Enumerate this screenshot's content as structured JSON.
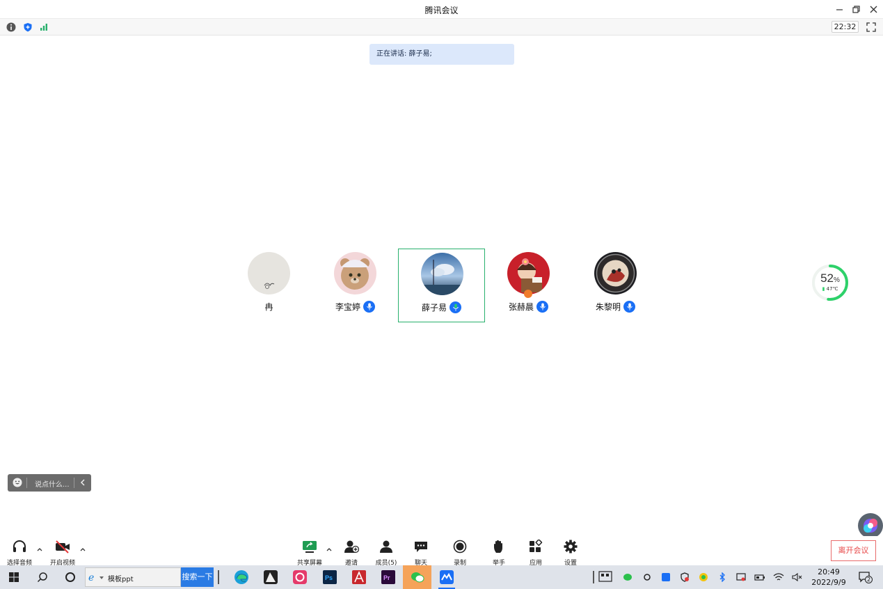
{
  "window": {
    "title": "腾讯会议"
  },
  "infobar": {
    "timer": "22:32"
  },
  "speaking": {
    "text": "正在讲话: 薛子易;"
  },
  "participants": [
    {
      "name": "冉",
      "mic": false
    },
    {
      "name": "李宝婷",
      "mic": true
    },
    {
      "name": "薛子易",
      "mic": true,
      "active": true
    },
    {
      "name": "张赫晨",
      "mic": true
    },
    {
      "name": "朱黎明",
      "mic": true
    }
  ],
  "gauge": {
    "percent_value": "52",
    "percent_sign": "%",
    "temp": "47℃"
  },
  "chat": {
    "placeholder": "说点什么..."
  },
  "toolbar": {
    "audio": "选择音频",
    "video": "开启视频",
    "share": "共享屏幕",
    "invite": "邀请",
    "members": "成员(5)",
    "chat": "聊天",
    "record": "录制",
    "raise": "举手",
    "apps": "应用",
    "settings": "设置",
    "leave": "离开会议"
  },
  "taskbar": {
    "search_text": "模板ppt",
    "search_button": "搜索一下",
    "time": "20:49",
    "date": "2022/9/9",
    "notifications": "2"
  },
  "colors": {
    "accent": "#1a6ff5",
    "active_border": "#27b06c",
    "leave": "#e84a4a",
    "speaking_bg": "#dce8fb"
  }
}
